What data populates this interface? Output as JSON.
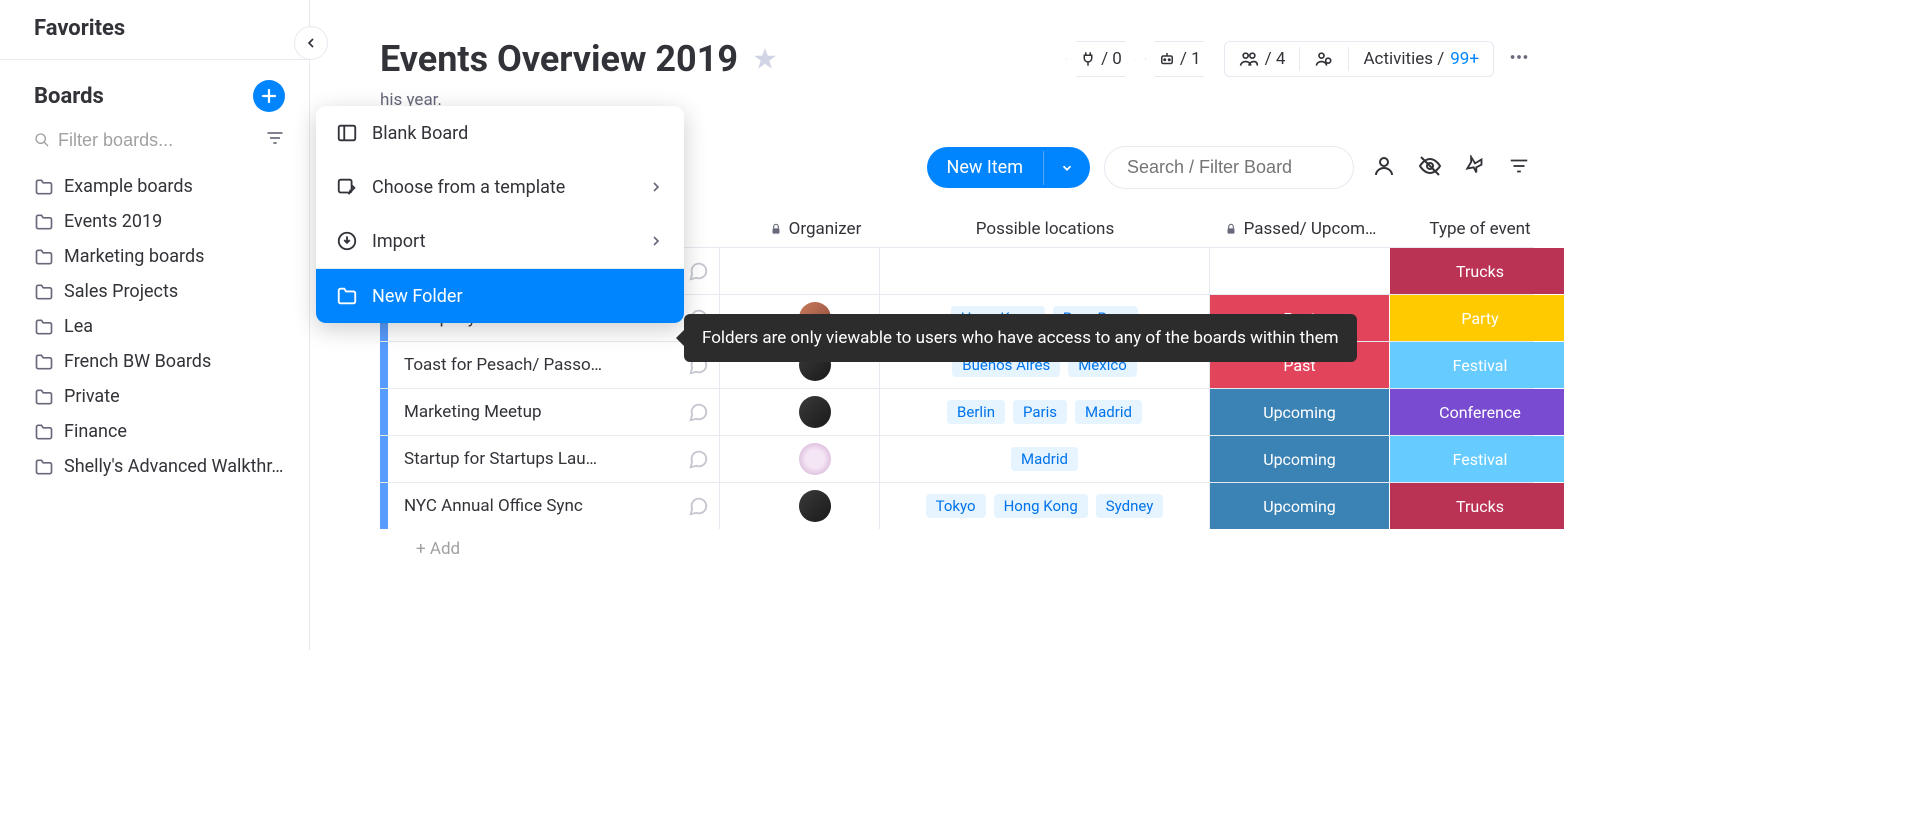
{
  "sidebar": {
    "favorites_title": "Favorites",
    "boards_title": "Boards",
    "filter_placeholder": "Filter boards...",
    "items": [
      "Example boards",
      "Events 2019",
      "Marketing boards",
      "Sales Projects",
      "Lea",
      "French BW Boards",
      "Private",
      "Finance",
      "Shelly's Advanced Walkthr…"
    ]
  },
  "popup": {
    "blank_board": "Blank Board",
    "template": "Choose from a template",
    "import": "Import",
    "new_folder": "New Folder"
  },
  "tooltip": "Folders are only viewable to users who have access to any of the boards within them",
  "header": {
    "title": "Events Overview 2019",
    "subtitle_fragment": "his year.",
    "integrations": "/ 0",
    "automations": "/ 1",
    "members": "/ 4",
    "activities_label": "Activities /",
    "activities_count": "99+"
  },
  "toolbar": {
    "new_item": "New Item",
    "search_placeholder": "Search / Filter Board"
  },
  "table": {
    "columns": {
      "organizer": "Organizer",
      "locations": "Possible locations",
      "status": "Passed/ Upcom…",
      "type": "Type of event"
    },
    "rows": [
      {
        "name": "",
        "avatar": "",
        "locations": [],
        "status": "",
        "status_color": "",
        "type": "Trucks",
        "type_color": "#bb3354",
        "hidden": true
      },
      {
        "name": "Company Offsite for 2020",
        "avatar": "a1",
        "locations": [
          "Hong Kong",
          "Bora Bora"
        ],
        "status": "Past",
        "status_color": "#e2445c",
        "type": "Party",
        "type_color": "#ffcb00"
      },
      {
        "name": "Toast for Pesach/ Passo…",
        "avatar": "a2",
        "locations": [
          "Buenos Aires",
          "Mexico"
        ],
        "status": "Past",
        "status_color": "#e2445c",
        "type": "Festival",
        "type_color": "#66ccff"
      },
      {
        "name": "Marketing Meetup",
        "avatar": "a2",
        "locations": [
          "Berlin",
          "Paris",
          "Madrid"
        ],
        "status": "Upcoming",
        "status_color": "#3b82b5",
        "type": "Conference",
        "type_color": "#784bd1"
      },
      {
        "name": "Startup for Startups Lau…",
        "avatar": "a3",
        "locations": [
          "Madrid"
        ],
        "status": "Upcoming",
        "status_color": "#3b82b5",
        "type": "Festival",
        "type_color": "#66ccff"
      },
      {
        "name": "NYC Annual Office Sync",
        "avatar": "a2",
        "locations": [
          "Tokyo",
          "Hong Kong",
          "Sydney"
        ],
        "status": "Upcoming",
        "status_color": "#3b82b5",
        "type": "Trucks",
        "type_color": "#bb3354"
      }
    ],
    "add_label": "+ Add"
  }
}
